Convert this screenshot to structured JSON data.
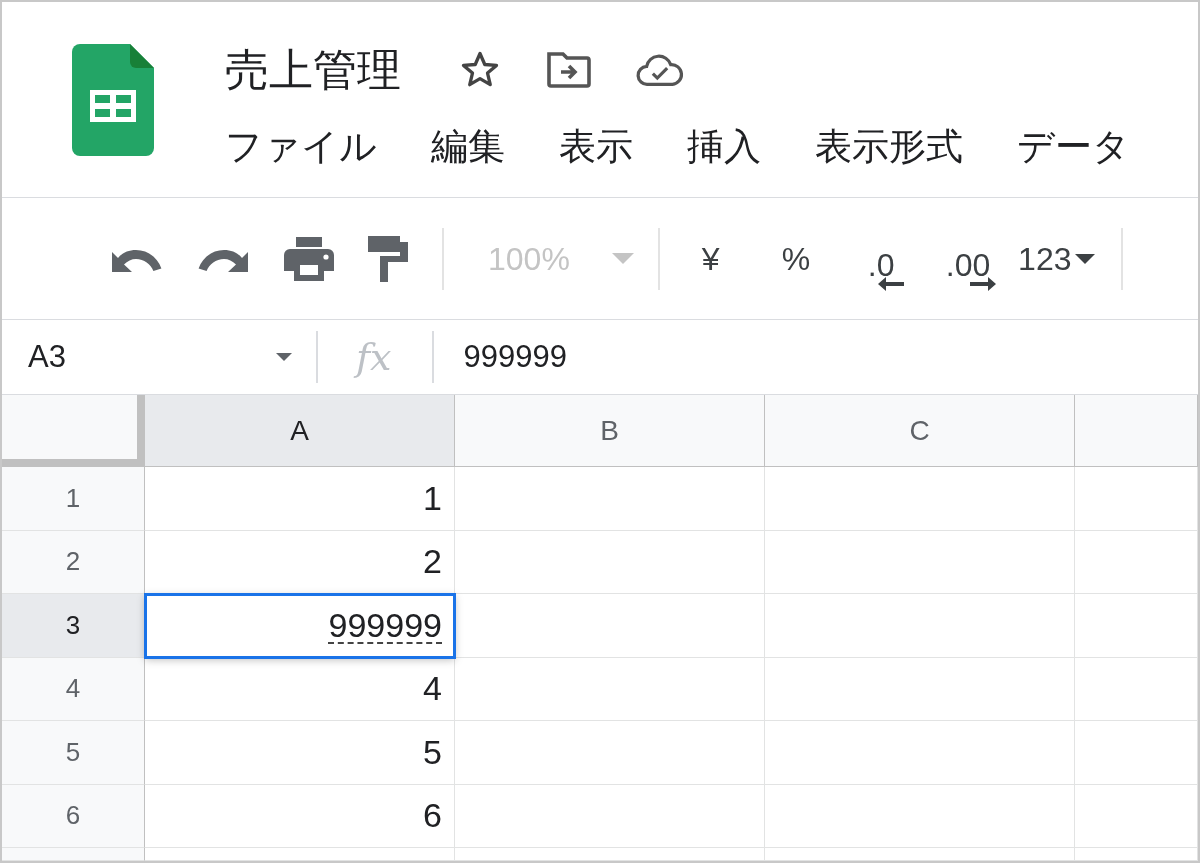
{
  "document": {
    "title": "売上管理"
  },
  "menu": [
    {
      "label": "ファイル"
    },
    {
      "label": "編集"
    },
    {
      "label": "表示"
    },
    {
      "label": "挿入"
    },
    {
      "label": "表示形式"
    },
    {
      "label": "データ"
    }
  ],
  "toolbar": {
    "zoom": {
      "value": "100%",
      "disabled": true
    },
    "currency": "¥",
    "percent": "%",
    "decimal_decrease": ".0",
    "decimal_increase": ".00",
    "number_format": "123"
  },
  "formula_bar": {
    "name_box": "A3",
    "function_label": "fx",
    "formula": "999999"
  },
  "grid": {
    "columns": [
      {
        "label": "A",
        "selected": true
      },
      {
        "label": "B",
        "selected": false
      },
      {
        "label": "C",
        "selected": false
      }
    ],
    "rows": [
      {
        "label": "1",
        "selected": false,
        "cells": [
          {
            "value": "1",
            "selected": false,
            "dotted_underline": false
          }
        ]
      },
      {
        "label": "2",
        "selected": false,
        "cells": [
          {
            "value": "2",
            "selected": false,
            "dotted_underline": false
          }
        ]
      },
      {
        "label": "3",
        "selected": true,
        "cells": [
          {
            "value": "999999",
            "selected": true,
            "dotted_underline": true
          }
        ]
      },
      {
        "label": "4",
        "selected": false,
        "cells": [
          {
            "value": "4",
            "selected": false,
            "dotted_underline": false
          }
        ]
      },
      {
        "label": "5",
        "selected": false,
        "cells": [
          {
            "value": "5",
            "selected": false,
            "dotted_underline": false
          }
        ]
      },
      {
        "label": "6",
        "selected": false,
        "cells": [
          {
            "value": "6",
            "selected": false,
            "dotted_underline": false
          }
        ]
      }
    ]
  }
}
